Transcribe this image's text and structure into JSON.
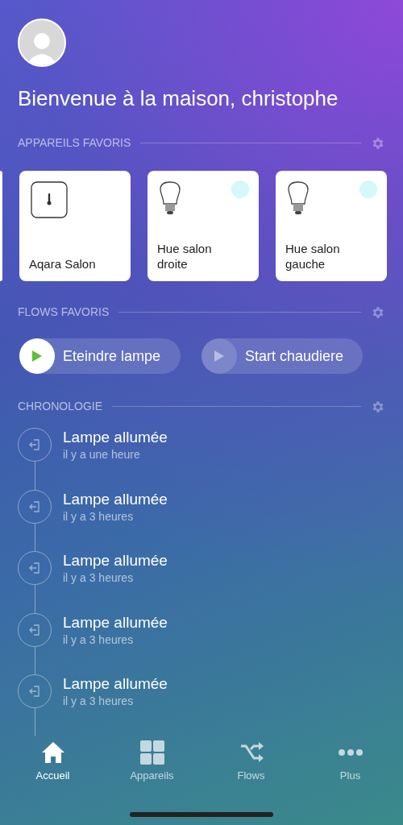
{
  "greeting": "Bienvenue à la maison, christophe",
  "favorite_devices": {
    "heading": "APPAREILS FAVORIS",
    "items": [
      {
        "kind": "sensor",
        "name": "Aqara Salon",
        "on": false
      },
      {
        "kind": "bulb",
        "name": "Hue salon droite",
        "on": true
      },
      {
        "kind": "bulb",
        "name": "Hue salon gauche",
        "on": true
      }
    ]
  },
  "favorite_flows": {
    "heading": "FLOWS FAVORIS",
    "items": [
      {
        "name": "Eteindre lampe",
        "active": true
      },
      {
        "name": "Start chaudiere",
        "active": false
      }
    ]
  },
  "timeline": {
    "heading": "CHRONOLOGIE",
    "items": [
      {
        "title": "Lampe allumée",
        "time": "il y a une heure"
      },
      {
        "title": "Lampe allumée",
        "time": "il y a 3 heures"
      },
      {
        "title": "Lampe allumée",
        "time": "il y a 3 heures"
      },
      {
        "title": "Lampe allumée",
        "time": "il y a 3 heures"
      },
      {
        "title": "Lampe allumée",
        "time": "il y a 3 heures"
      }
    ]
  },
  "nav": [
    {
      "kind": "home",
      "label": "Accueil",
      "selected": true
    },
    {
      "kind": "grid",
      "label": "Appareils",
      "selected": false
    },
    {
      "kind": "shuffle",
      "label": "Flows",
      "selected": false
    },
    {
      "kind": "more",
      "label": "Plus",
      "selected": false
    }
  ]
}
